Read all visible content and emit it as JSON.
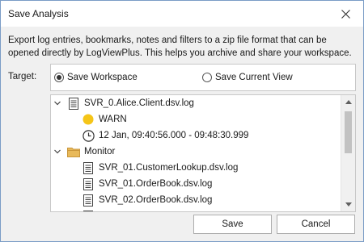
{
  "window": {
    "title": "Save Analysis"
  },
  "description": "Export log entries, bookmarks, notes and filters to a zip file format that can be opened directly by LogViewPlus.  This helps you archive and share your workspace.",
  "target": {
    "label": "Target:",
    "options": [
      {
        "label": "Save Workspace",
        "selected": true
      },
      {
        "label": "Save Current View",
        "selected": false
      }
    ]
  },
  "tree": {
    "items": [
      {
        "label": "SVR_0.Alice.Client.dsv.log",
        "icon": "document-icon",
        "expanded": true
      },
      {
        "label": "WARN",
        "icon": "yellow-dot-icon"
      },
      {
        "label": "12 Jan, 09:40:56.000 - 09:48:30.999",
        "icon": "clock-icon"
      },
      {
        "label": "Monitor",
        "icon": "folder-icon",
        "expanded": true
      },
      {
        "label": "SVR_01.CustomerLookup.dsv.log",
        "icon": "document-icon"
      },
      {
        "label": "SVR_01.OrderBook.dsv.log",
        "icon": "document-icon"
      },
      {
        "label": "SVR_02.OrderBook.dsv.log",
        "icon": "document-icon"
      }
    ]
  },
  "buttons": {
    "save": "Save",
    "cancel": "Cancel"
  },
  "colors": {
    "warn_dot": "#f5c518",
    "folder": "#e8b95a",
    "window_border": "#7a9cc6"
  }
}
